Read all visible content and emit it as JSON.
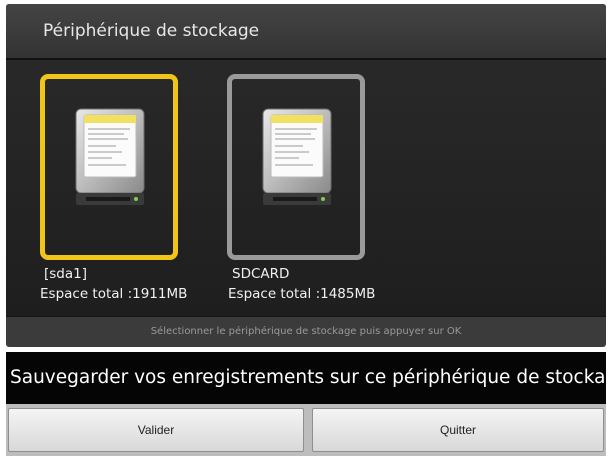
{
  "window": {
    "title": "Périphérique de stockage"
  },
  "devices": [
    {
      "name": "[sda1]",
      "space": "Espace total :1911MB",
      "selected": true
    },
    {
      "name": "SDCARD",
      "space": "Espace total :1485MB",
      "selected": false
    }
  ],
  "status": {
    "text": "Sélectionner le périphérique de stockage puis appuyer sur OK"
  },
  "dialog": {
    "question": "Sauvegarder vos enregistrements sur ce périphérique de stockage?",
    "confirm_label": "Valider",
    "cancel_label": "Quitter"
  },
  "colors": {
    "selection": "#f0c419",
    "unselected_border": "#9a9a9a"
  },
  "icons": {
    "device": "hard-drive-icon"
  }
}
